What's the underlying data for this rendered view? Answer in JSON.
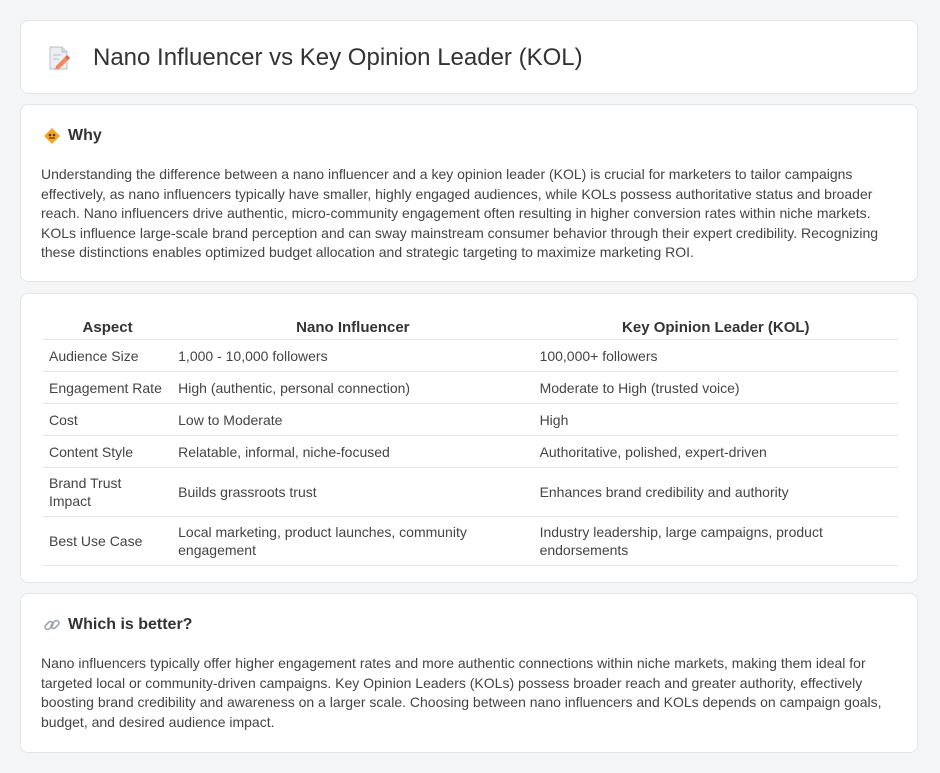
{
  "title": "Nano Influencer vs Key Opinion Leader (KOL)",
  "why": {
    "heading": "Why",
    "text": "Understanding the difference between a nano influencer and a key opinion leader (KOL) is crucial for marketers to tailor campaigns effectively, as nano influencers typically have smaller, highly engaged audiences, while KOLs possess authoritative status and broader reach. Nano influencers drive authentic, micro-community engagement often resulting in higher conversion rates within niche markets. KOLs influence large-scale brand perception and can sway mainstream consumer behavior through their expert credibility. Recognizing these distinctions enables optimized budget allocation and strategic targeting to maximize marketing ROI."
  },
  "table": {
    "headers": [
      "Aspect",
      "Nano Influencer",
      "Key Opinion Leader (KOL)"
    ],
    "rows": [
      [
        "Audience Size",
        "1,000 - 10,000 followers",
        "100,000+ followers"
      ],
      [
        "Engagement Rate",
        "High (authentic, personal connection)",
        "Moderate to High (trusted voice)"
      ],
      [
        "Cost",
        "Low to Moderate",
        "High"
      ],
      [
        "Content Style",
        "Relatable, informal, niche-focused",
        "Authoritative, polished, expert-driven"
      ],
      [
        "Brand Trust Impact",
        "Builds grassroots trust",
        "Enhances brand credibility and authority"
      ],
      [
        "Best Use Case",
        "Local marketing, product launches, community engagement",
        "Industry leadership, large campaigns, product endorsements"
      ]
    ]
  },
  "better": {
    "heading": "Which is better?",
    "text": "Nano influencers typically offer higher engagement rates and more authentic connections within niche markets, making them ideal for targeted local or community-driven campaigns. Key Opinion Leaders (KOLs) possess broader reach and greater authority, effectively boosting brand credibility and awareness on a larger scale. Choosing between nano influencers and KOLs depends on campaign goals, budget, and desired audience impact."
  },
  "icons": {
    "title": "document-edit-icon",
    "why": "diamond-sign-icon",
    "better": "chain-link-icon"
  }
}
